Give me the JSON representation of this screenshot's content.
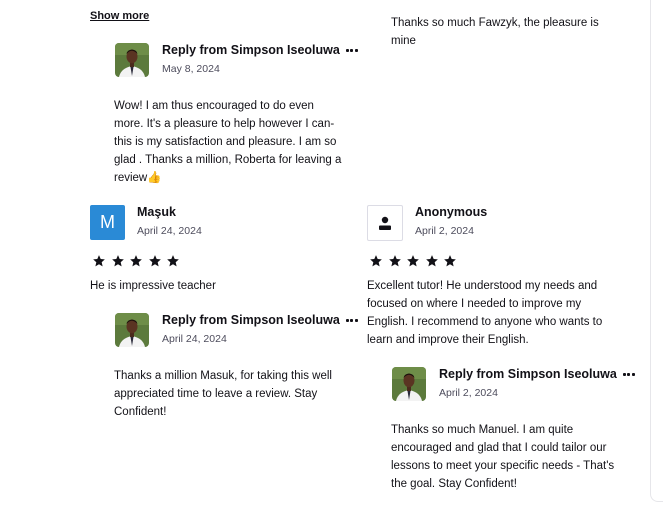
{
  "col_left": {
    "show_more": "Show more",
    "reply1": {
      "name": "Reply from Simpson Iseoluwa",
      "date": "May 8, 2024",
      "lines": [
        "Wow! I am thus encouraged to do even",
        "more. It's a pleasure to help however I can-",
        "this is my satisfaction and pleasure. I am so",
        "glad . Thanks a million, Roberta for leaving a",
        "review👍"
      ]
    },
    "review": {
      "avatar_letter": "M",
      "name": "Maşuk",
      "date": "April 24, 2024",
      "rating": 5,
      "text": "He is impressive teacher"
    },
    "reply2": {
      "name": "Reply from Simpson Iseoluwa",
      "date": "April 24, 2024",
      "lines": [
        "Thanks a million Masuk, for taking this well",
        "appreciated time to leave a review. Stay",
        "Confident!"
      ]
    }
  },
  "col_right": {
    "top_reply_lines": [
      "Thanks so much Fawzyk, the pleasure is",
      "mine"
    ],
    "review": {
      "avatar_icon": "person-icon",
      "name": "Anonymous",
      "date": "April 2, 2024",
      "rating": 5,
      "lines": [
        "Excellent tutor! He understood my needs and",
        "focused on where I needed to improve my",
        "English. I recommend to anyone who wants to",
        "learn and improve their English."
      ]
    },
    "reply": {
      "name": "Reply from Simpson Iseoluwa",
      "date": "April 2, 2024",
      "lines": [
        "Thanks so much Manuel. I am quite",
        "encouraged and glad that I could tailor our",
        "lessons to meet your specific needs - That's",
        "the goal. Stay Confident!"
      ]
    }
  },
  "colors": {
    "star": "#121117",
    "avatar_blue": "#2a8ad6",
    "text": "#121117",
    "muted": "#4d4c5c"
  }
}
